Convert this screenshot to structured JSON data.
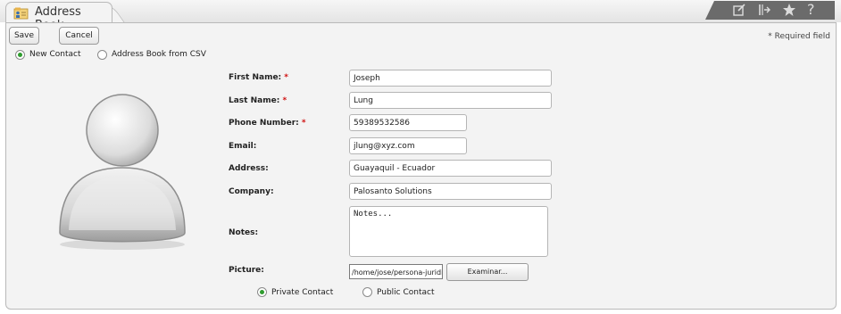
{
  "app": {
    "title": "Address Book"
  },
  "toolbar": {
    "icons": [
      "edit-icon",
      "export-icon",
      "star-icon",
      "help-icon"
    ]
  },
  "actions": {
    "save": "Save",
    "cancel": "Cancel"
  },
  "required_note": "* Required field",
  "mode": {
    "options": [
      "New Contact",
      "Address Book from CSV"
    ],
    "selected": "New Contact"
  },
  "form": {
    "first_name": {
      "label": "First Name:",
      "required_mark": "*",
      "value": "Joseph"
    },
    "last_name": {
      "label": "Last Name:",
      "required_mark": "*",
      "value": "Lung"
    },
    "phone": {
      "label": "Phone Number:",
      "required_mark": "*",
      "value": "59389532586"
    },
    "email": {
      "label": "Email:",
      "value": "jlung@xyz.com"
    },
    "address": {
      "label": "Address:",
      "value": "Guayaquil - Ecuador"
    },
    "company": {
      "label": "Company:",
      "value": "Palosanto Solutions"
    },
    "notes": {
      "label": "Notes:",
      "value": "Notes..."
    },
    "picture": {
      "label": "Picture:",
      "value": "/home/jose/persona-juridica.jpg",
      "button": "Examinar..."
    }
  },
  "visibility": {
    "options": [
      "Private Contact",
      "Public Contact"
    ],
    "selected": "Private Contact"
  },
  "colors": {
    "required": "#d01010",
    "radio_on": "#2e9c2e",
    "toolbar": "#6b6b6b"
  }
}
